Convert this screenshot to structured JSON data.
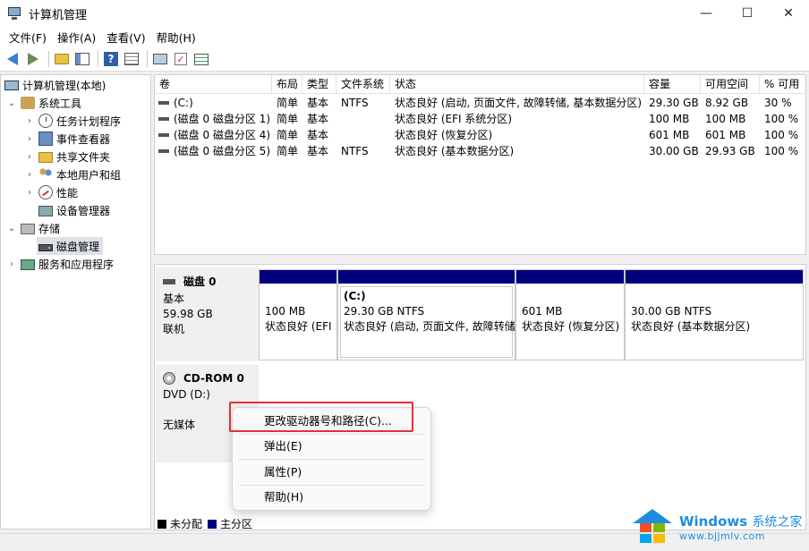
{
  "window": {
    "title": "计算机管理",
    "minimize": "—",
    "maximize": "☐",
    "close": "✕"
  },
  "menu": [
    "文件(F)",
    "操作(A)",
    "查看(V)",
    "帮助(H)"
  ],
  "toolbar": {
    "help_glyph": "?",
    "check_glyph": "✓"
  },
  "tree": {
    "root": "计算机管理(本地)",
    "system_tools": "系统工具",
    "task_scheduler": "任务计划程序",
    "event_viewer": "事件查看器",
    "shared_folders": "共享文件夹",
    "local_users": "本地用户和组",
    "performance": "性能",
    "device_manager": "设备管理器",
    "storage": "存储",
    "disk_management": "磁盘管理",
    "services_apps": "服务和应用程序",
    "chev_open": "⌄",
    "chev_closed": "›"
  },
  "volumes": {
    "headers": [
      "卷",
      "布局",
      "类型",
      "文件系统",
      "状态",
      "容量",
      "可用空间",
      "% 可用"
    ],
    "rows": [
      [
        "(C:)",
        "简单",
        "基本",
        "NTFS",
        "状态良好 (启动, 页面文件, 故障转储, 基本数据分区)",
        "29.30 GB",
        "8.92 GB",
        "30 %"
      ],
      [
        "(磁盘 0 磁盘分区 1)",
        "简单",
        "基本",
        "",
        "状态良好 (EFI 系统分区)",
        "100 MB",
        "100 MB",
        "100 %"
      ],
      [
        "(磁盘 0 磁盘分区 4)",
        "简单",
        "基本",
        "",
        "状态良好 (恢复分区)",
        "601 MB",
        "601 MB",
        "100 %"
      ],
      [
        "(磁盘 0 磁盘分区 5)",
        "简单",
        "基本",
        "NTFS",
        "状态良好 (基本数据分区)",
        "30.00 GB",
        "29.93 GB",
        "100 %"
      ]
    ]
  },
  "disk0": {
    "name": "磁盘 0",
    "type": "基本",
    "size": "59.98 GB",
    "status": "联机",
    "partitions": [
      {
        "title": "",
        "line1": "100 MB",
        "line2": "状态良好 (EFI"
      },
      {
        "title": "(C:)",
        "line1": "29.30 GB NTFS",
        "line2": "状态良好 (启动, 页面文件, 故障转储"
      },
      {
        "title": "",
        "line1": "601 MB",
        "line2": "状态良好 (恢复分区)"
      },
      {
        "title": "",
        "line1": "30.00 GB NTFS",
        "line2": "状态良好 (基本数据分区)"
      }
    ]
  },
  "cdrom0": {
    "name": "CD-ROM 0",
    "type": "DVD (D:)",
    "status": "无媒体"
  },
  "legend": [
    {
      "label": "未分配",
      "color": "#000000"
    },
    {
      "label": "主分区",
      "color": "#00007f"
    }
  ],
  "context_menu": [
    "更改驱动器号和路径(C)...",
    "弹出(E)",
    "属性(P)",
    "帮助(H)"
  ],
  "watermark": {
    "brand": "Windows",
    "suffix": "系统之家",
    "url": "www.bjjmlv.com"
  },
  "colors": {
    "primary_partition": "#00007f",
    "highlight": "#e0303a",
    "brand_blue": "#1e8de0"
  }
}
